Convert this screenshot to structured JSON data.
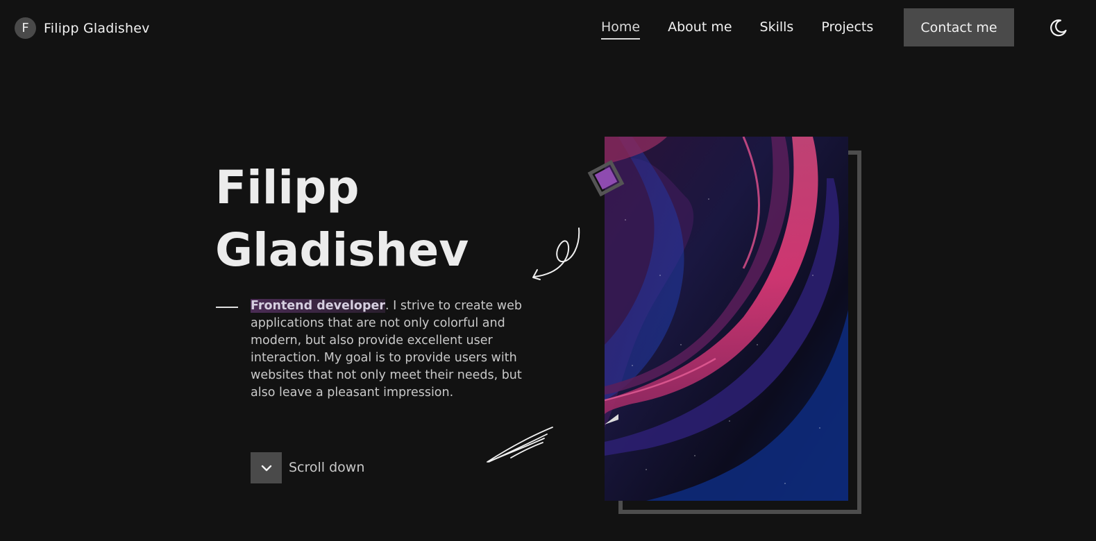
{
  "header": {
    "brand_initial": "F",
    "brand_name": "Filipp Gladishev",
    "nav": [
      {
        "label": "Home",
        "active": true
      },
      {
        "label": "About me",
        "active": false
      },
      {
        "label": "Skills",
        "active": false
      },
      {
        "label": "Projects",
        "active": false
      }
    ],
    "contact_label": "Contact me",
    "theme_icon": "moon-icon"
  },
  "hero": {
    "title_line1": "Filipp",
    "title_line2": "Gladishev",
    "role": "Frontend developer",
    "description_rest": ". I strive to create web applications that are not only colorful and modern, but also provide excellent user interaction. My goal is to provide users with websites that not only meet their needs, but also leave a pleasant impression.",
    "scroll_label": "Scroll down",
    "scroll_icon": "chevron-down-icon"
  },
  "colors": {
    "background": "#121212",
    "button": "#4a4a4a",
    "accent_purple": "#8e4bb0",
    "frame": "#4d4d4d"
  }
}
